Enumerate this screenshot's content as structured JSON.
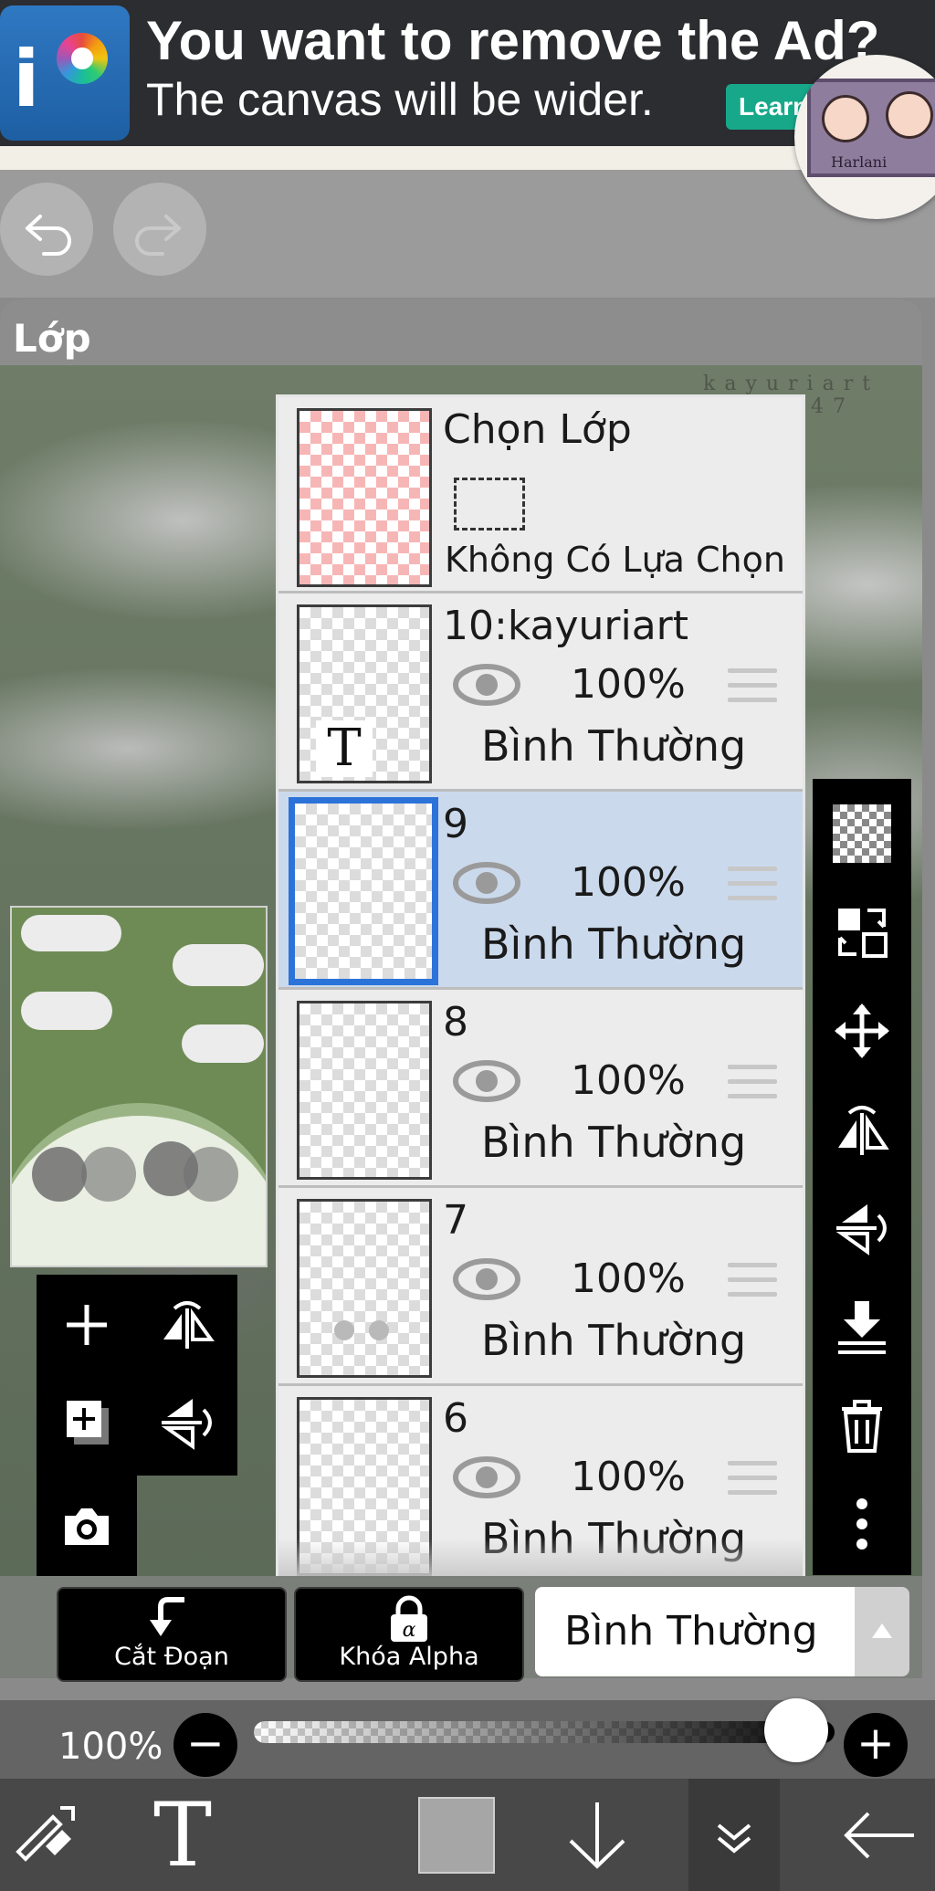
{
  "ad": {
    "title": "You want to remove the Ad?",
    "subtitle": "The canvas will be wider.",
    "cta": "Learn"
  },
  "watermark": "kayuriart",
  "watermark_num": "47",
  "avatar_text": "Harlani",
  "panel": {
    "title": "Lớp"
  },
  "selection_layer": {
    "name": "Chọn Lớp",
    "status": "Không Có Lựa Chọn"
  },
  "layers": [
    {
      "name": "10:kayuriart",
      "opacity": "100%",
      "mode": "Bình Thường",
      "selected": false,
      "type": "text"
    },
    {
      "name": "9",
      "opacity": "100%",
      "mode": "Bình Thường",
      "selected": true,
      "type": "raster"
    },
    {
      "name": "8",
      "opacity": "100%",
      "mode": "Bình Thường",
      "selected": false,
      "type": "raster"
    },
    {
      "name": "7",
      "opacity": "100%",
      "mode": "Bình Thường",
      "selected": false,
      "type": "raster"
    },
    {
      "name": "6",
      "opacity": "100%",
      "mode": "Bình Thường",
      "selected": false,
      "type": "raster"
    }
  ],
  "text_layer_mark": "T",
  "actions": {
    "clipping_label": "Cắt Đoạn",
    "alpha_lock_label": "Khóa Alpha",
    "alpha_glyph": "α",
    "blend_mode": "Bình Thường"
  },
  "opacity": {
    "label": "100%",
    "value": 100,
    "minus": "−",
    "plus": "+"
  },
  "bottom_tools": {
    "text_tool": "T"
  },
  "colors": {
    "selected_row": "#cbd9ec",
    "selected_border": "#2c73d9",
    "toolbar": "#000000",
    "ad_cta": "#17a88a",
    "current_color": "#a6a6a6"
  }
}
